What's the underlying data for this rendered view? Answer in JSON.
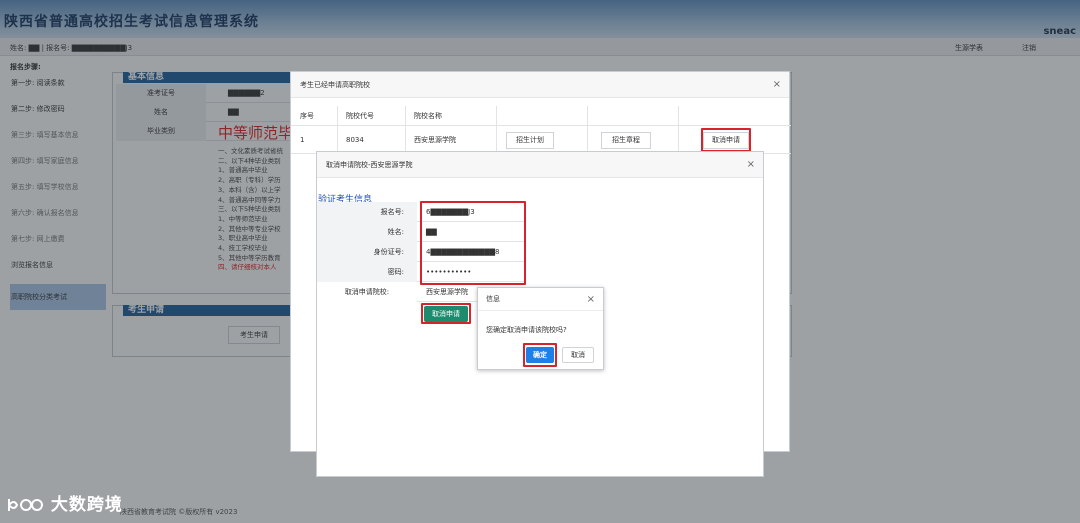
{
  "header": {
    "title": "陕西省普通高校招生考试信息管理系统",
    "tag": "sneac"
  },
  "userbar": {
    "info": "姓名: ▇▇ | 报名号: ▇▇▇▇▇▇▇▇▇▇J3",
    "link_1": "生源学表",
    "link_2": "注销"
  },
  "steps": {
    "title": "报名步骤:",
    "items": [
      "第一步: 阅读条款",
      "第二步: 修改密码",
      "第三步: 填写基本信息",
      "第四步: 填写家庭信息",
      "第五步: 填写学校信息",
      "第六步: 确认报名信息",
      "第七步: 网上缴费",
      "浏览报名信息",
      "高职院校分类考试"
    ]
  },
  "basic_info": {
    "title": "基本信息",
    "rows": [
      {
        "k": "准考证号",
        "v": "▇▇▇▇▇▇2"
      },
      {
        "k": "姓名",
        "v": "▇▇"
      },
      {
        "k": "毕业类别",
        "v": ""
      }
    ],
    "category": "中等师范毕",
    "rules": [
      "一、文化素质考试省统",
      "二、以下4种毕业类别",
      "1、普通高中毕业",
      "2、高职（专科）学历",
      "3、本科（含）以上学",
      "4、普通高中同等学力",
      "三、以下5种毕业类别",
      "1、中等师范毕业",
      "2、其他中等专业学校",
      "3、职业高中毕业",
      "4、技工学校毕业",
      "5、其他中等学历教育"
    ],
    "warning": "四、请仔细核对本人"
  },
  "apply_section": {
    "title": "考生申请",
    "button": "考生申请"
  },
  "footer": "陕西省教育考试院 ©版权所有 v2023",
  "watermark": "大数跨境",
  "applied_dialog": {
    "title": "考生已经申请高职院校",
    "close": "×",
    "headers": [
      "序号",
      "院校代号",
      "院校名称"
    ],
    "row": {
      "no": "1",
      "code": "8034",
      "name": "西安思源学院",
      "btn_plan": "招生计划",
      "btn_rules": "招生章程",
      "btn_cancel": "取消申请"
    }
  },
  "cancel_dialog": {
    "title": "取消申请院校-西安思源学院",
    "close": "×",
    "verify_title": "验证考生信息",
    "fields": [
      {
        "k": "报名号:",
        "v": "6▇▇▇▇▇▇▇J3"
      },
      {
        "k": "姓名:",
        "v": "▇▇"
      },
      {
        "k": "身份证号:",
        "v": "4▇▇▇▇▇▇▇▇▇▇▇▇8"
      },
      {
        "k": "密码:",
        "v": "•••••••••••"
      }
    ],
    "school_label": "取消申请院校:",
    "school_value": "西安思源学院",
    "button": "取消申请"
  },
  "confirm_dialog": {
    "title": "信息",
    "close": "×",
    "message": "您确定取消申请该院校吗?",
    "ok": "确定",
    "cancel": "取消"
  }
}
